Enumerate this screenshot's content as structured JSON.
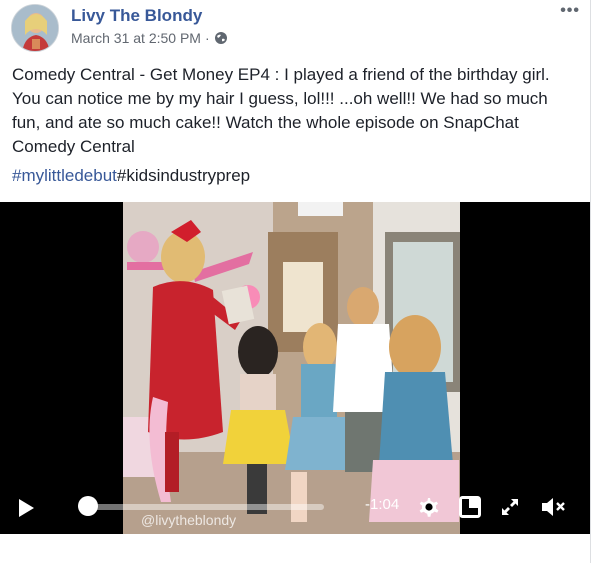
{
  "post": {
    "author": "Livy The Blondy",
    "timestamp": "March 31 at 2:50 PM",
    "separator": "·",
    "privacy_icon": "globe-icon",
    "more_icon": "more-options-icon",
    "text": "Comedy Central - Get Money EP4 : I played a friend of the birthday girl. You can notice me by my hair I guess, lol!!! ...oh well!! We had so much fun, and ate so much cake!! Watch the whole episode on SnapChat Comedy Central",
    "hashtags": [
      "#mylittledebut",
      "#kidsindustryprep"
    ]
  },
  "video": {
    "time_remaining": "-1:04",
    "watermark": "@livytheblondy",
    "progress_fraction": 0.0,
    "controls": [
      "play-icon",
      "settings-icon",
      "picture-in-picture-icon",
      "fullscreen-icon",
      "volume-muted-icon"
    ]
  },
  "colors": {
    "link": "#385898",
    "text": "#1d2129",
    "meta": "#616770"
  }
}
